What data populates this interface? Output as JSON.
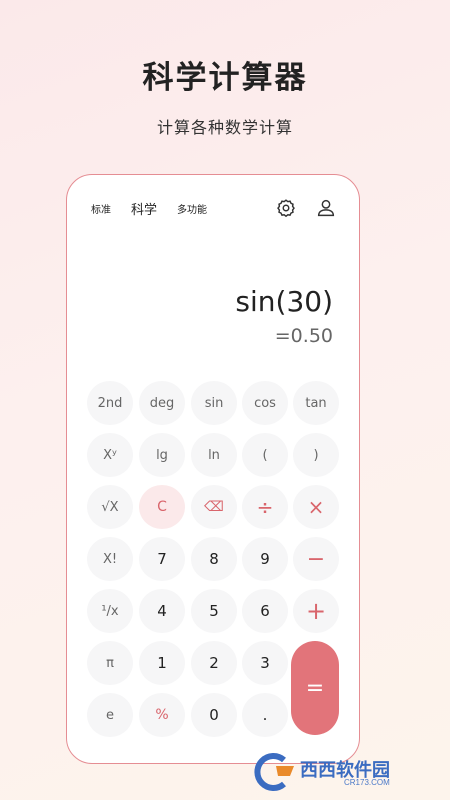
{
  "promo": {
    "title": "科学计算器",
    "subtitle": "计算各种数学计算"
  },
  "topbar": {
    "tabs": [
      {
        "label": "标准",
        "active": false
      },
      {
        "label": "科学",
        "active": true
      },
      {
        "label": "多功能",
        "active": false
      }
    ],
    "settings_icon": "gear-icon",
    "profile_icon": "user-icon"
  },
  "display": {
    "expression": "sin(30)",
    "result": "=0.50"
  },
  "keys": {
    "row1": [
      "2nd",
      "deg",
      "sin",
      "cos",
      "tan"
    ],
    "row2": [
      "Xʸ",
      "lg",
      "ln",
      "(",
      ")"
    ],
    "row3": [
      "√X",
      "C",
      "⌫",
      "÷",
      "×"
    ],
    "row4": [
      "X!",
      "7",
      "8",
      "9",
      "−"
    ],
    "row5": [
      "¹/x",
      "4",
      "5",
      "6",
      "+"
    ],
    "row6": [
      "π",
      "1",
      "2",
      "3"
    ],
    "row7": [
      "e",
      "%",
      "0",
      "."
    ],
    "equals": "="
  },
  "colors": {
    "accent": "#e2747a",
    "accent_text": "#d9656c",
    "key_bg": "#f6f6f7"
  },
  "watermark": {
    "text": "西西软件园",
    "sub": "CR173.COM"
  }
}
